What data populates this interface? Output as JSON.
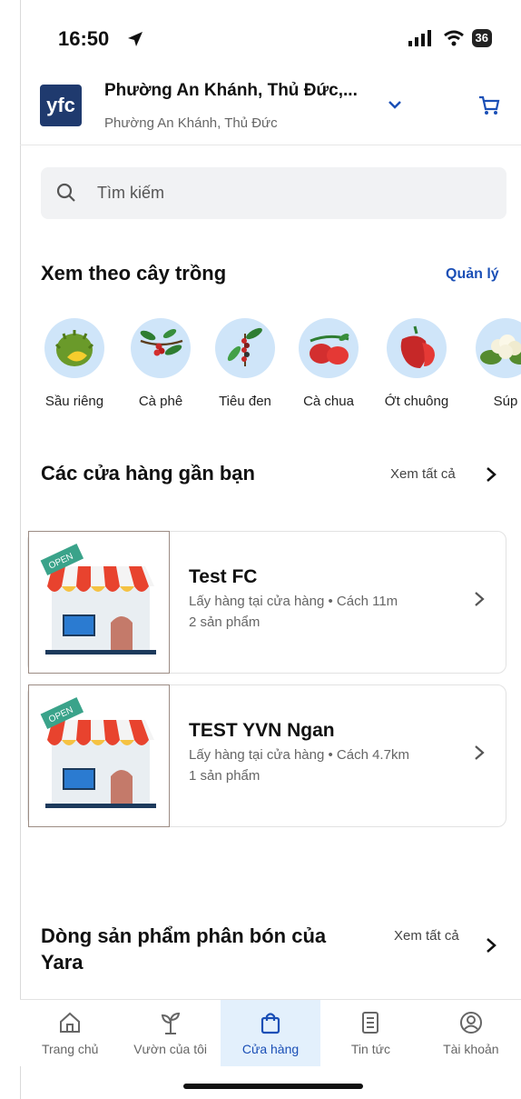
{
  "status": {
    "time": "16:50",
    "battery": "36"
  },
  "header": {
    "logo_text": "yfc",
    "address_title": "Phường An Khánh, Thủ Đức,...",
    "address_sub": "Phường An Khánh, Thủ Đức"
  },
  "search": {
    "placeholder": "Tìm kiếm"
  },
  "crops_section": {
    "title": "Xem theo cây trồng",
    "manage_label": "Quản lý",
    "items": [
      {
        "label": "Sầu riêng",
        "icon": "durian-icon"
      },
      {
        "label": "Cà phê",
        "icon": "coffee-plant-icon"
      },
      {
        "label": "Tiêu đen",
        "icon": "black-pepper-icon"
      },
      {
        "label": "Cà chua",
        "icon": "tomato-icon"
      },
      {
        "label": "Ớt chuông",
        "icon": "bell-pepper-icon"
      },
      {
        "label": "Súp",
        "icon": "cauliflower-icon"
      }
    ]
  },
  "stores_section": {
    "title": "Các cửa hàng gần bạn",
    "see_all_label": "Xem tất cả",
    "stores": [
      {
        "name": "Test FC",
        "meta": "Lấy hàng tại cửa hàng • Cách 11m",
        "count": "2 sản phẩm",
        "badge": "OPEN"
      },
      {
        "name": "TEST YVN Ngan",
        "meta": "Lấy hàng tại cửa hàng • Cách 4.7km",
        "count": "1 sản phẩm",
        "badge": "OPEN"
      }
    ]
  },
  "yara_section": {
    "title": "Dòng sản phẩm phân bón của Yara",
    "see_all_label": "Xem tất cả"
  },
  "tabbar": {
    "tabs": [
      {
        "label": "Trang chủ",
        "active": false
      },
      {
        "label": "Vườn của tôi",
        "active": false
      },
      {
        "label": "Cửa hàng",
        "active": true
      },
      {
        "label": "Tin tức",
        "active": false
      },
      {
        "label": "Tài khoản",
        "active": false
      }
    ]
  },
  "colors": {
    "accent": "#1a4fb6",
    "logo_bg": "#1f3a6e",
    "crop_circle": "#cfe5f9",
    "active_tab_bg": "#e3f0fc"
  }
}
